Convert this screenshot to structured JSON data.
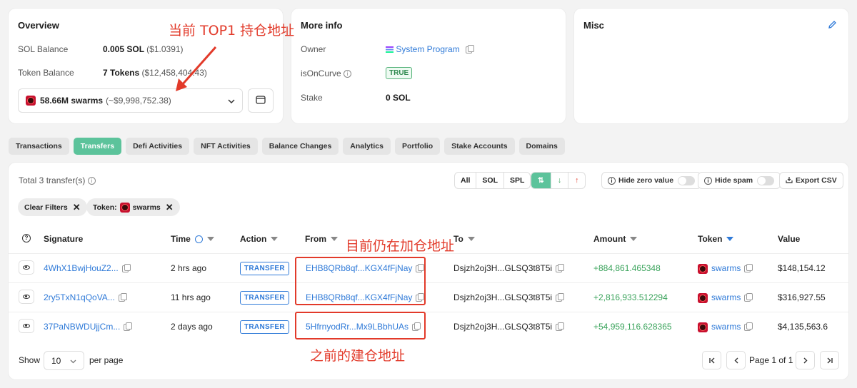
{
  "overview": {
    "title": "Overview",
    "sol_balance_label": "SOL Balance",
    "sol_balance_value": "0.005 SOL",
    "sol_balance_usd": "($1.0391)",
    "token_balance_label": "Token Balance",
    "token_balance_value": "7 Tokens",
    "token_balance_usd": "($12,458,404.43)",
    "token_selected_amount": "58.66M swarms",
    "token_selected_usd": "(~$9,998,752.38)"
  },
  "more_info": {
    "title": "More info",
    "owner_label": "Owner",
    "owner_value": "System Program",
    "is_on_curve_label": "isOnCurve",
    "is_on_curve_value": "TRUE",
    "stake_label": "Stake",
    "stake_value": "0 SOL"
  },
  "misc": {
    "title": "Misc"
  },
  "tabs": [
    "Transactions",
    "Transfers",
    "Defi Activities",
    "NFT Activities",
    "Balance Changes",
    "Analytics",
    "Portfolio",
    "Stake Accounts",
    "Domains"
  ],
  "transfers": {
    "total_label": "Total 3 transfer(s)",
    "type_filters": [
      "All",
      "SOL",
      "SPL"
    ],
    "hide_zero_label": "Hide zero value",
    "hide_spam_label": "Hide spam",
    "export_label": "Export CSV",
    "clear_filters_label": "Clear Filters",
    "token_filter_label": "Token:",
    "token_filter_value": "swarms",
    "columns": {
      "signature": "Signature",
      "time": "Time",
      "action": "Action",
      "from": "From",
      "to": "To",
      "amount": "Amount",
      "token": "Token",
      "value": "Value"
    },
    "rows": [
      {
        "signature": "4WhX1BwjHouZ2...",
        "time": "2 hrs ago",
        "action": "TRANSFER",
        "from": "EHB8QRb8qf...KGX4fFjNay",
        "to": "Dsjzh2oj3H...GLSQ3t8T5i",
        "amount": "+884,861.465348",
        "token": "swarms",
        "value": "$148,154.12"
      },
      {
        "signature": "2ry5TxN1qQoVA...",
        "time": "11 hrs ago",
        "action": "TRANSFER",
        "from": "EHB8QRb8qf...KGX4fFjNay",
        "to": "Dsjzh2oj3H...GLSQ3t8T5i",
        "amount": "+2,816,933.512294",
        "token": "swarms",
        "value": "$316,927.55"
      },
      {
        "signature": "37PaNBWDUjjCm...",
        "time": "2 days ago",
        "action": "TRANSFER",
        "from": "5HfrnyodRr...Mx9LBbhUAs",
        "to": "Dsjzh2oj3H...GLSQ3t8T5i",
        "amount": "+54,959,116.628365",
        "token": "swarms",
        "value": "$4,135,563.6"
      }
    ],
    "show_label": "Show",
    "per_page_value": "10",
    "per_page_label": "per page",
    "page_label": "Page 1 of 1"
  },
  "annotations": {
    "top1_holder": "当前 TOP1 持仓地址",
    "still_adding": "目前仍在加仓地址",
    "earlier_builder": "之前的建仓地址"
  },
  "colors": {
    "accent_green": "#5cc39b",
    "link_blue": "#2f7ad8",
    "annotation_red": "#e23a2a"
  }
}
